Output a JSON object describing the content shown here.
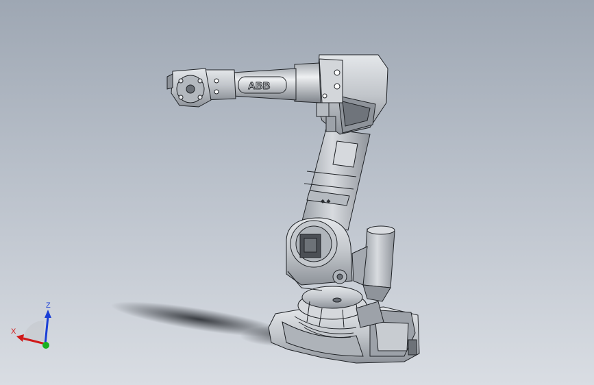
{
  "viewport": {
    "background_top": "#9ea7b3",
    "background_bottom": "#d9dde3"
  },
  "model": {
    "brand_text": "ABB",
    "body_color": "#c9cdd2",
    "shade_color": "#8c9198",
    "dark_color": "#4b4f55",
    "edge_color": "#1f2226"
  },
  "triad": {
    "x_label": "X",
    "z_label": "Z",
    "x_color": "#d01818",
    "z_color": "#1a3fd6",
    "y_color": "#18b020"
  }
}
